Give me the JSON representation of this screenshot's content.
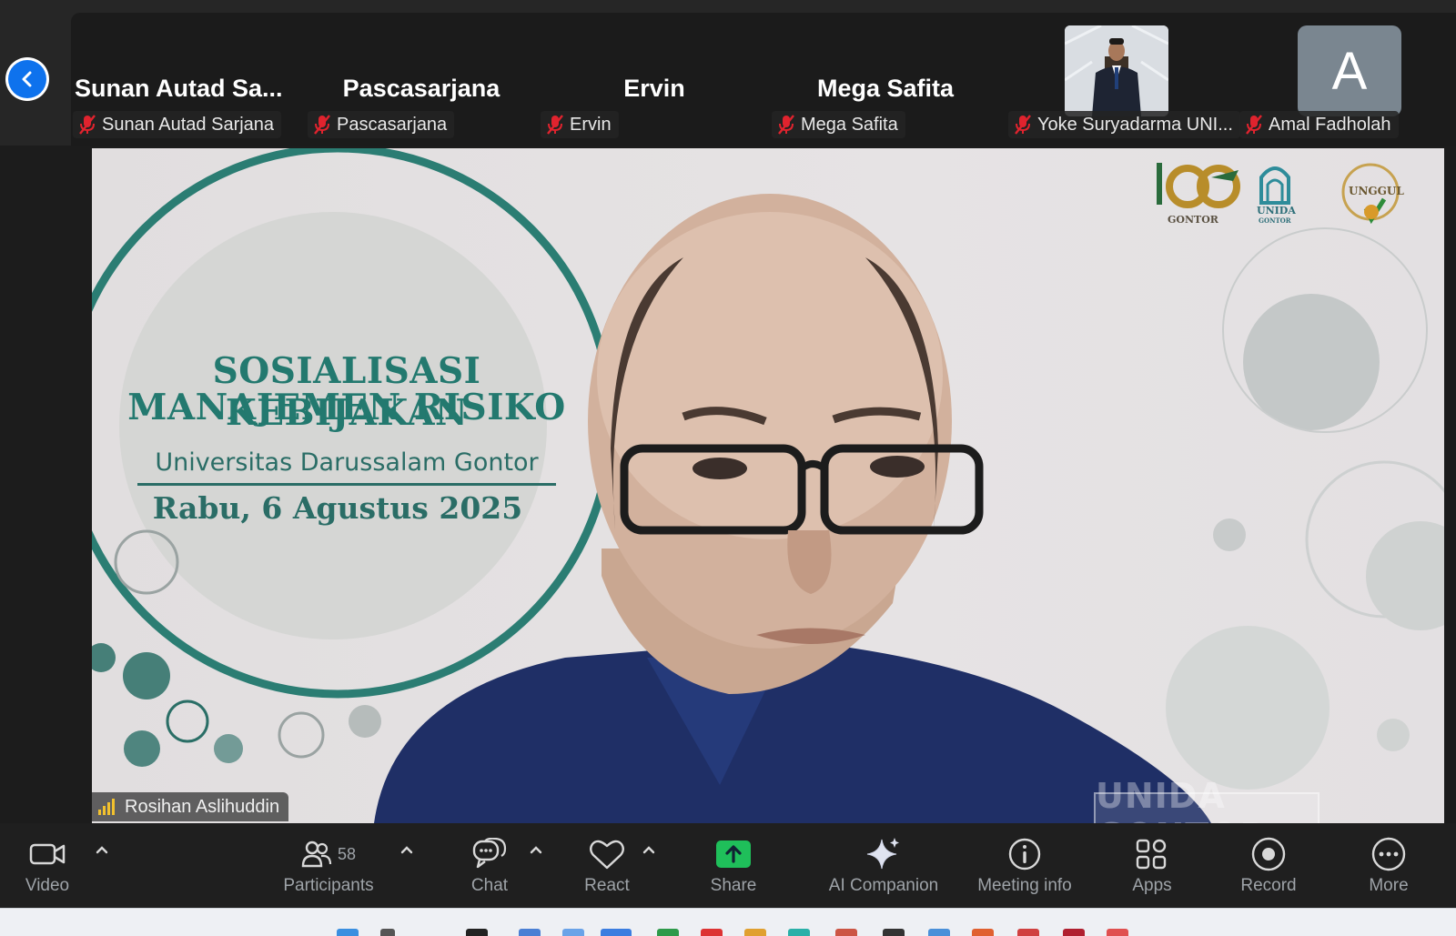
{
  "participants_strip": [
    {
      "name": "Sunan  Autad  Sa...",
      "label": "Sunan Autad Sarjana",
      "muted": true
    },
    {
      "name": "Pascasarjana",
      "label": "Pascasarjana",
      "muted": true
    },
    {
      "name": "Ervin",
      "label": "Ervin",
      "muted": true
    },
    {
      "name": "Mega Safita",
      "label": "Mega Safita",
      "muted": true
    },
    {
      "name": "",
      "label": "Yoke Suryadarma UNI...",
      "muted": true,
      "has_video": true
    },
    {
      "name": "",
      "label": "Amal Fadholah",
      "muted": true,
      "avatar_letter": "A"
    }
  ],
  "main_video": {
    "speaker_label": "Rosihan Aslihuddin",
    "slide": {
      "line1": "SOSIALISASI KEBIJAKAN",
      "line2": "MANAJEMEN RISIKO",
      "university": "Universitas Darussalam Gontor",
      "date": "Rabu, 6 Agustus 2025"
    },
    "logos": {
      "gontor": "GONTOR",
      "unida": "UNIDA",
      "unida_sub": "GONTOR",
      "unggul": "UNGGUL"
    },
    "watermark": "UNIDA GONTOR"
  },
  "toolbar": {
    "video": "Video",
    "participants": "Participants",
    "participants_count": "58",
    "chat": "Chat",
    "react": "React",
    "share": "Share",
    "ai_companion": "AI Companion",
    "meeting_info": "Meeting info",
    "apps": "Apps",
    "record": "Record",
    "more": "More"
  },
  "colors": {
    "accent_blue": "#0e72ed",
    "share_green": "#1fbf5a",
    "mute_red": "#e0232e",
    "slide_teal": "#23796f"
  }
}
